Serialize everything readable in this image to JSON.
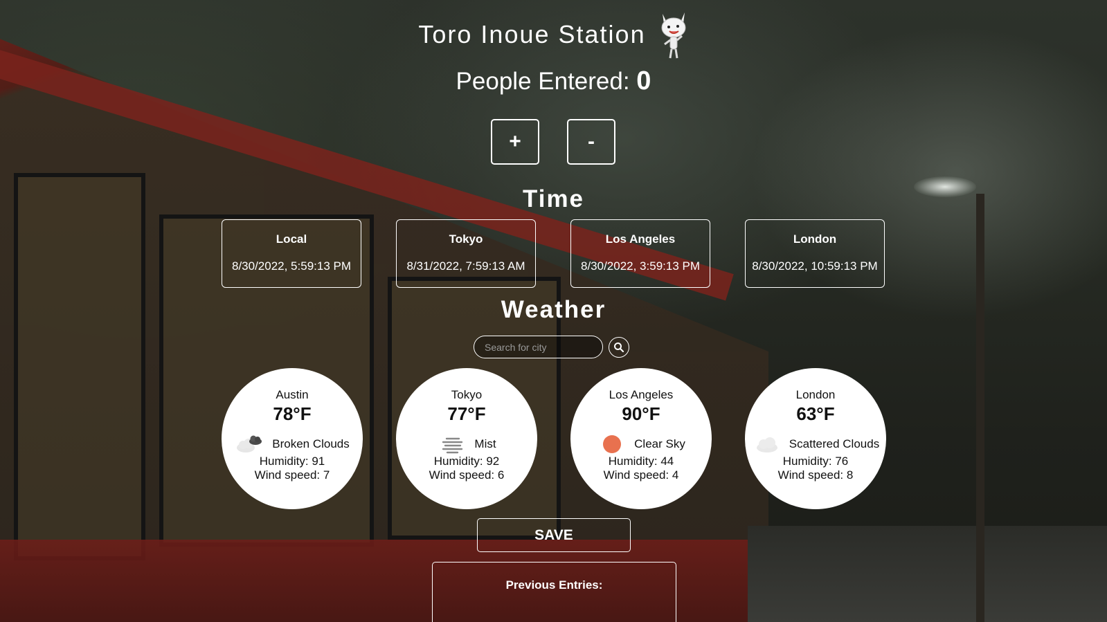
{
  "app": {
    "title": "Toro Inoue Station",
    "mascot_icon": "toro-cat-mascot"
  },
  "counter": {
    "label": "People Entered:",
    "value": "0",
    "increment_label": "+",
    "decrement_label": "-"
  },
  "time": {
    "heading": "Time",
    "clocks": [
      {
        "label": "Local",
        "time": "8/30/2022, 5:59:13 PM"
      },
      {
        "label": "Tokyo",
        "time": "8/31/2022, 7:59:13 AM"
      },
      {
        "label": "Los Angeles",
        "time": "8/30/2022, 3:59:13 PM"
      },
      {
        "label": "London",
        "time": "8/30/2022, 10:59:13 PM"
      }
    ]
  },
  "weather": {
    "heading": "Weather",
    "search": {
      "placeholder": "Search for city",
      "value": "",
      "icon": "search-icon"
    },
    "cards": [
      {
        "city": "Austin",
        "temp": "78°F",
        "condition": "Broken Clouds",
        "icon": "broken-clouds-icon",
        "humidity": "Humidity: 91",
        "wind": "Wind speed: 7"
      },
      {
        "city": "Tokyo",
        "temp": "77°F",
        "condition": "Mist",
        "icon": "mist-icon",
        "humidity": "Humidity: 92",
        "wind": "Wind speed: 6"
      },
      {
        "city": "Los Angeles",
        "temp": "90°F",
        "condition": "Clear Sky",
        "icon": "clear-sky-icon",
        "humidity": "Humidity: 44",
        "wind": "Wind speed: 4"
      },
      {
        "city": "London",
        "temp": "63°F",
        "condition": "Scattered Clouds",
        "icon": "scattered-clouds-icon",
        "humidity": "Humidity: 76",
        "wind": "Wind speed: 8"
      }
    ]
  },
  "save": {
    "label": "SAVE"
  },
  "entries": {
    "label": "Previous Entries:"
  },
  "colors": {
    "text": "#ffffff",
    "card_bg": "#ffffff",
    "sun": "#e8714f"
  }
}
